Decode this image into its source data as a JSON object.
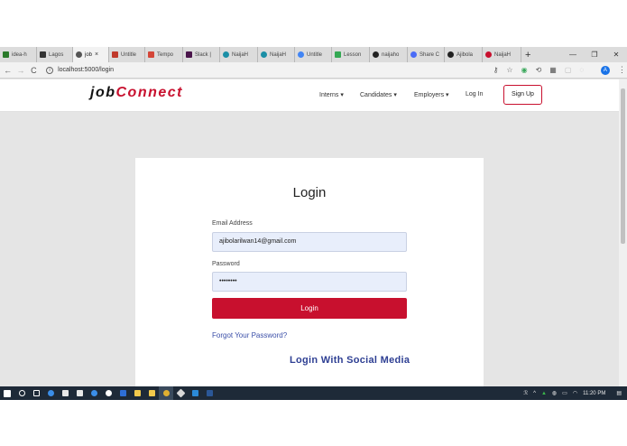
{
  "browser": {
    "tabs": [
      {
        "label": "idea-h",
        "color": "#2a7a2a"
      },
      {
        "label": "Lagos",
        "color": "#333333"
      },
      {
        "label": "job",
        "color": "#555555",
        "active": true
      },
      {
        "label": "Untitle",
        "color": "#c0392b"
      },
      {
        "label": "Tempo",
        "color": "#d44638"
      },
      {
        "label": "Slack |",
        "color": "#4a154b"
      },
      {
        "label": "NaijaH",
        "color": "#1b8fa6"
      },
      {
        "label": "NaijaH",
        "color": "#1b8fa6"
      },
      {
        "label": "Untitle",
        "color": "#4285f4"
      },
      {
        "label": "Lesson",
        "color": "#34a853"
      },
      {
        "label": "naijaho",
        "color": "#222222"
      },
      {
        "label": "Share C",
        "color": "#4a6cf7"
      },
      {
        "label": "Ajibola",
        "color": "#222222"
      },
      {
        "label": "NaijaH",
        "color": "#c8102e"
      }
    ],
    "active_tab_close": "×",
    "new_tab": "+",
    "window_controls": [
      "—",
      "❐",
      "✕"
    ],
    "url": "localhost:5000/login",
    "profile_initial": "A"
  },
  "site": {
    "logo_part1": "job",
    "logo_part2": "Connect",
    "nav": {
      "interns": "Interns ▾",
      "candidates": "Candidates ▾",
      "employers": "Employers ▾",
      "login": "Log In",
      "signup": "Sign Up"
    },
    "login": {
      "title": "Login",
      "email_label": "Email Address",
      "email_value": "ajibolarilwan14@gmail.com",
      "password_label": "Password",
      "password_value": "••••••••",
      "submit": "Login",
      "forgot": "Forgot Your Password?",
      "social": "Login With Social Media"
    }
  },
  "taskbar": {
    "time": "11:20 PM"
  },
  "colors": {
    "brand_red": "#c8102e",
    "link_blue": "#2e3f93",
    "input_bg": "#e8eefb"
  }
}
